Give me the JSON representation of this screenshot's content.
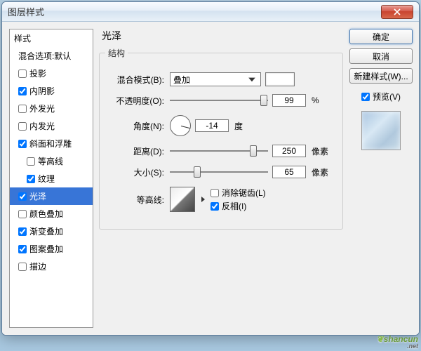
{
  "window": {
    "title": "图层样式"
  },
  "sidebar": {
    "header": "样式",
    "blend_options": "混合选项:默认",
    "items": [
      {
        "label": "投影",
        "checked": false,
        "indent": 0
      },
      {
        "label": "内阴影",
        "checked": true,
        "indent": 0
      },
      {
        "label": "外发光",
        "checked": false,
        "indent": 0
      },
      {
        "label": "内发光",
        "checked": false,
        "indent": 0
      },
      {
        "label": "斜面和浮雕",
        "checked": true,
        "indent": 0
      },
      {
        "label": "等高线",
        "checked": false,
        "indent": 1
      },
      {
        "label": "纹理",
        "checked": true,
        "indent": 1
      },
      {
        "label": "光泽",
        "checked": true,
        "indent": 0,
        "selected": true
      },
      {
        "label": "颜色叠加",
        "checked": false,
        "indent": 0
      },
      {
        "label": "渐变叠加",
        "checked": true,
        "indent": 0
      },
      {
        "label": "图案叠加",
        "checked": true,
        "indent": 0
      },
      {
        "label": "描边",
        "checked": false,
        "indent": 0
      }
    ]
  },
  "main": {
    "title": "光泽",
    "section_title": "结构",
    "blend_mode_label": "混合模式(B):",
    "blend_mode_value": "叠加",
    "opacity_label": "不透明度(O):",
    "opacity_value": "99",
    "opacity_unit": "%",
    "opacity_pct": 99,
    "angle_label": "角度(N):",
    "angle_value": "-14",
    "angle_unit": "度",
    "distance_label": "距离(D):",
    "distance_value": "250",
    "distance_unit": "像素",
    "distance_pct": 88,
    "size_label": "大小(S):",
    "size_value": "65",
    "size_unit": "像素",
    "size_pct": 26,
    "contour_label": "等高线:",
    "antialias_label": "消除锯齿(L)",
    "antialias_checked": false,
    "invert_label": "反相(I)",
    "invert_checked": true
  },
  "rightcol": {
    "ok": "确定",
    "cancel": "取消",
    "new_style": "新建样式(W)...",
    "preview": "预览(V)",
    "preview_checked": true
  },
  "watermark": {
    "text": "shancun",
    "sub": ".net"
  }
}
